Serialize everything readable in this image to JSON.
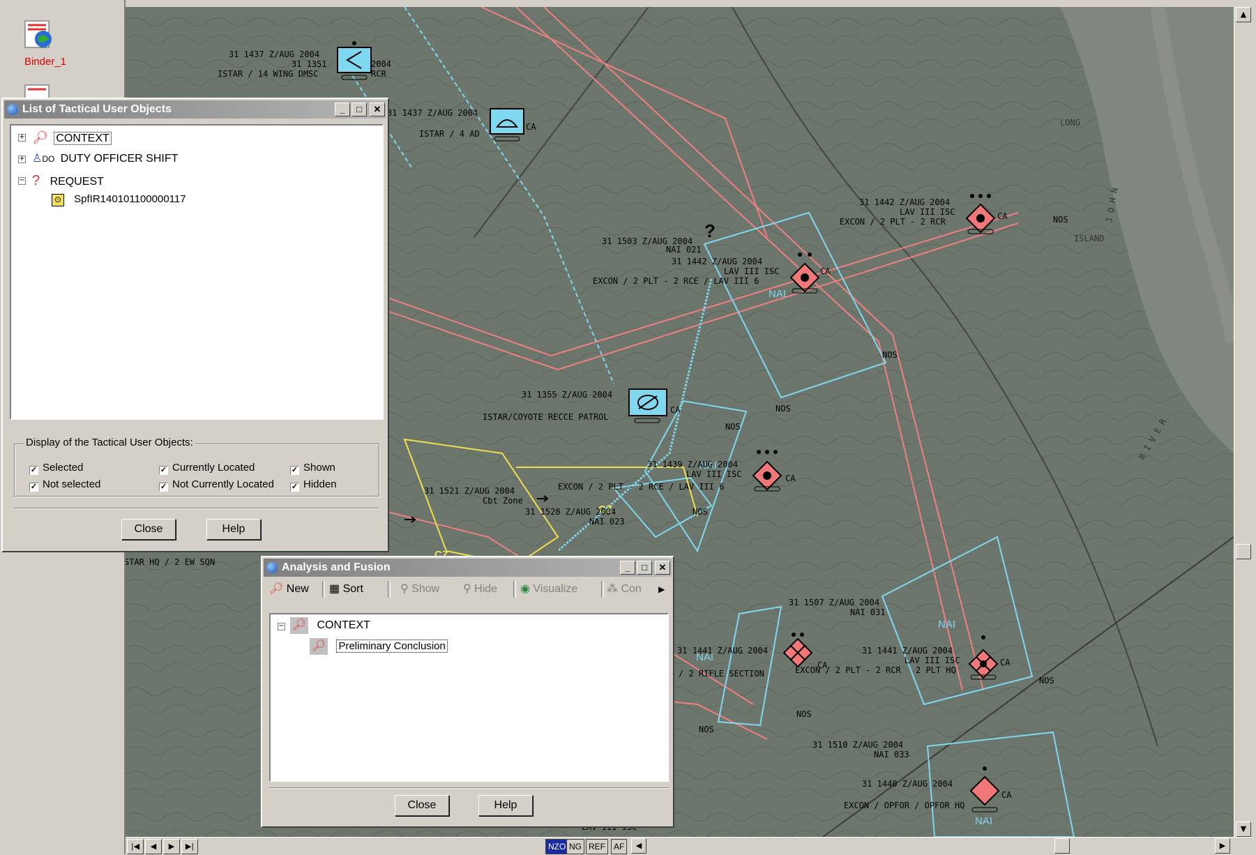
{
  "launcher": {
    "binder_label": "Binder_1"
  },
  "map": {
    "labels": {
      "l1a": "31 1437 Z/AUG 2004",
      "l1b": "31 1351",
      "l1c": "2004",
      "l1d": "ISTAR / 14 WING DMSC",
      "l1e": "RCR",
      "l2a": "31 1437 Z/AUG 2004",
      "l2b": "ISTAR / 4 AD",
      "l2c": "CA",
      "l3a": "31 1503 Z/AUG 2004",
      "l3b": "NAI 021",
      "l4a": "31 1442 Z/AUG 2004",
      "l4b": "LAV III ISC",
      "l4c": "CA",
      "l4d": "EXCON / 2 PLT - 2 RCE / LAV III 6",
      "l5a": "31 1442 Z/AUG 2004",
      "l5b": "LAV III ISC",
      "l5c": "EXCON / 2 PLT - 2 RCR",
      "l5d": "CA",
      "l5e": "NOS",
      "island": "ISLAND",
      "l6a": "31 1355 Z/AUG 2004",
      "l6b": "ISTAR/COYOTE RECCE PATROL",
      "l6c": "CA",
      "l7a": "31 1439 Z/AUG 2004",
      "l7b": "LAV III ISC",
      "l7c": "CA",
      "l8a": "31 1521 Z/AUG 2004",
      "l8b": "Cbt Zone",
      "l8c": "EXCON / 2 PLT - 2 RCE / LAV III 6",
      "l9a": "31 1528 Z/AUG 2004",
      "l9b": "NAI 023",
      "l10a": "STAR HQ / 2 EW SQN",
      "l11a": "31 1507 Z/AUG 2004",
      "l11b": "NAI 031",
      "l12a": "31 1441 Z/AUG 2004",
      "l12b": "/ 2 RIFLE SECTION",
      "l12c": "CA",
      "l13a": "31 1441 Z/AUG 2004",
      "l13b": "LAV III ISC",
      "l13c": "EXCON / 2 PLT - 2 RCR",
      "l13d": "2 PLT HQ",
      "l13e": "CA",
      "l14a": "31 1510 Z/AUG 2004",
      "l14b": "NAI 033",
      "l15a": "31 1440 Z/AUG 2004",
      "l15b": "EXCON / OPFOR / OPFOR HQ",
      "l15c": "CA",
      "l16a": "LAV III ISC",
      "nos": "NOS",
      "nai": "NAI",
      "cz": "CZ",
      "qmark": "?",
      "river1": "R I V E R",
      "river2": "J O H N",
      "long": "LONG"
    }
  },
  "tactical_window": {
    "title": "List of Tactical User Objects",
    "tree": [
      {
        "label": "CONTEXT",
        "prefix": ""
      },
      {
        "label": "DUTY OFFICER SHIFT",
        "prefix": "DO"
      },
      {
        "label": "REQUEST",
        "prefix": ""
      },
      {
        "label": "SpfIR140101100000117",
        "prefix": ""
      }
    ],
    "group_label": "Display of the Tactical User Objects:",
    "checkboxes": {
      "selected": "Selected",
      "not_selected": "Not selected",
      "currently_located": "Currently Located",
      "not_currently_located": "Not Currently Located",
      "shown": "Shown",
      "hidden": "Hidden"
    },
    "close_label": "Close",
    "help_label": "Help"
  },
  "analysis_window": {
    "title": "Analysis and Fusion",
    "toolbar": {
      "new": "New",
      "sort": "Sort",
      "show": "Show",
      "hide": "Hide",
      "visualize": "Visualize",
      "con": "Con"
    },
    "tree": [
      {
        "label": "CONTEXT"
      },
      {
        "label": "Preliminary Conclusion"
      }
    ],
    "close_label": "Close",
    "help_label": "Help"
  },
  "bottom_bar": {
    "tags": [
      "NZO",
      "NG",
      "REF",
      "AF"
    ]
  },
  "colors": {
    "friendly": "#7fd8f0",
    "hostile": "#f07878",
    "zone": "#f0e050",
    "route": "#f08080"
  }
}
